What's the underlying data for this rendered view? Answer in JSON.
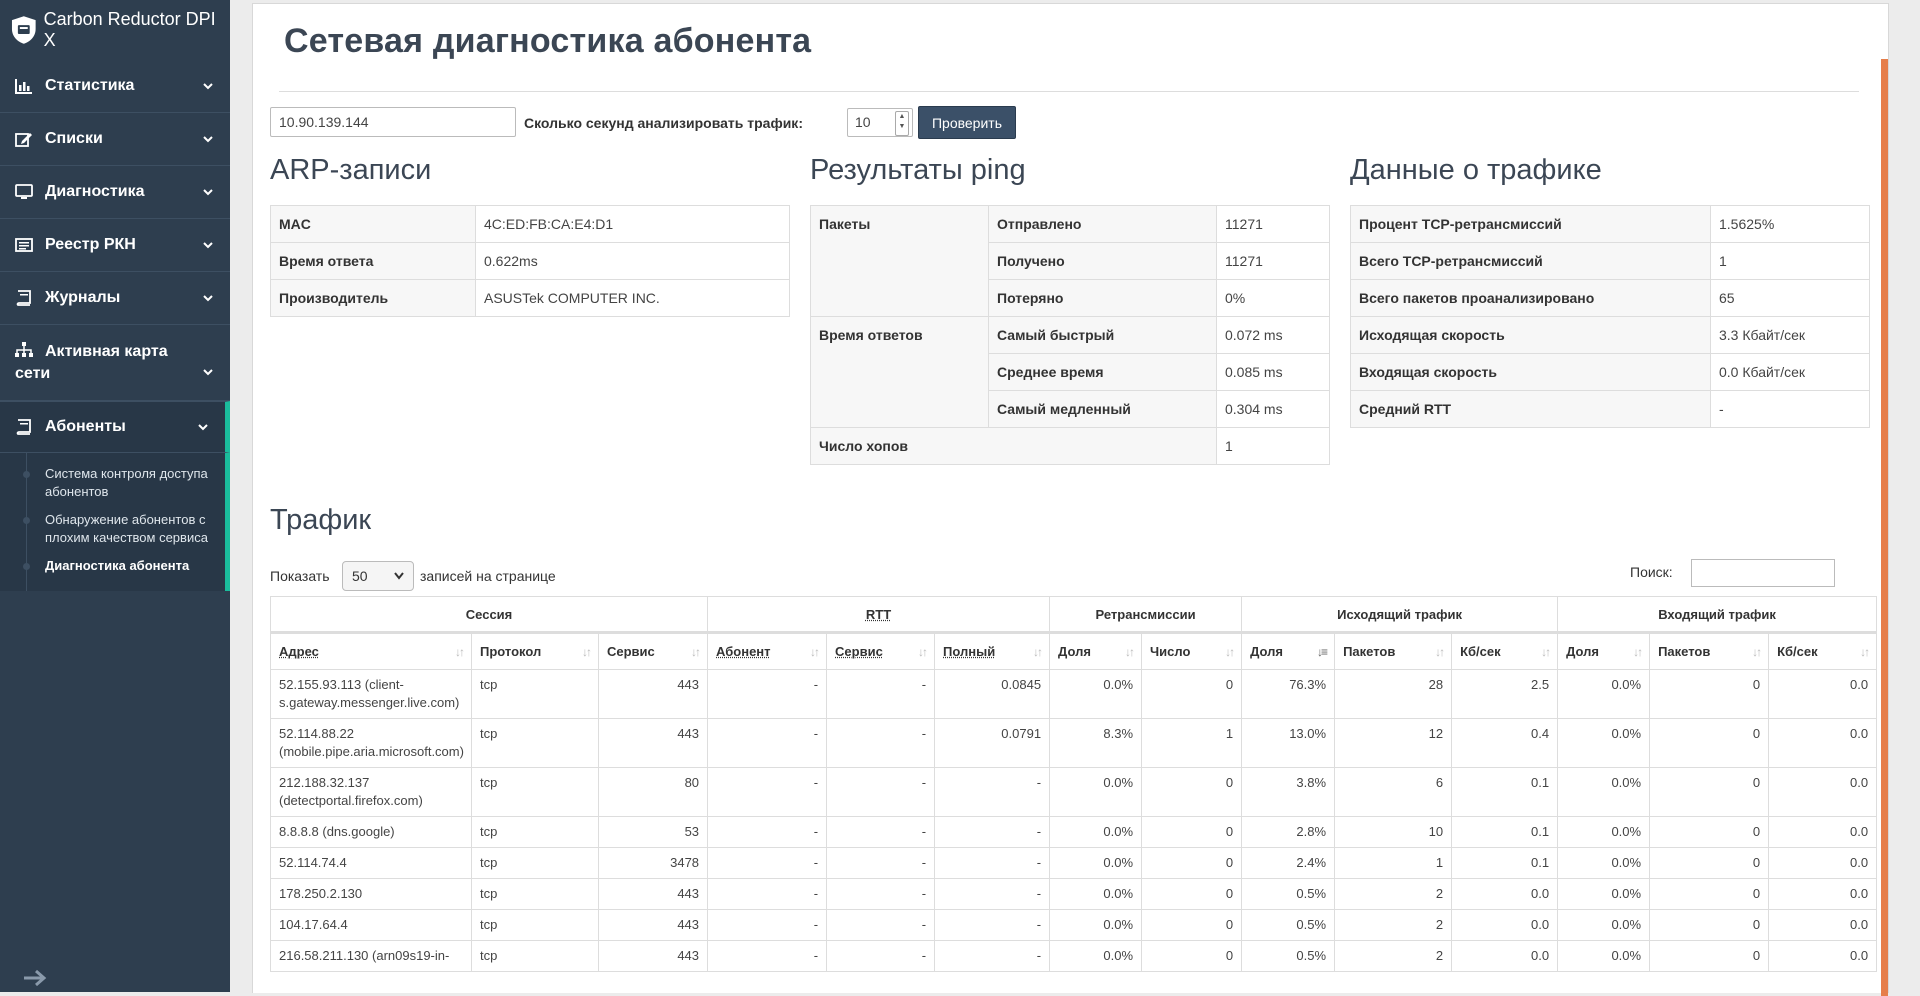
{
  "app": {
    "title": "Carbon Reductor DPI X"
  },
  "sidebar": {
    "items": [
      {
        "label": "Статистика",
        "icon": "bar-chart-icon"
      },
      {
        "label": "Списки",
        "icon": "edit-icon"
      },
      {
        "label": "Диагностика",
        "icon": "monitor-icon"
      },
      {
        "label": "Реестр РКН",
        "icon": "list-icon"
      },
      {
        "label": "Журналы",
        "icon": "book-icon"
      },
      {
        "label": "Активная карта сети",
        "label_line1": "Активная карта",
        "label_line2": "сети",
        "icon": "sitemap-icon"
      },
      {
        "label": "Абоненты",
        "icon": "book-icon"
      }
    ],
    "subitems": [
      {
        "line1": "Система контроля доступа",
        "line2": "абонентов"
      },
      {
        "line1": "Обнаружение абонентов с",
        "line2": "плохим качеством сервиса"
      },
      {
        "line1": "Диагностика абонента"
      }
    ]
  },
  "page": {
    "title": "Сетевая диагностика абонента",
    "ip_value": "10.90.139.144",
    "seconds_label": "Сколько секунд анализировать трафик:",
    "seconds_value": "10",
    "check_button": "Проверить"
  },
  "arp": {
    "heading": "ARP-записи",
    "rows": [
      {
        "k": "MAC",
        "v": "4C:ED:FB:CA:E4:D1"
      },
      {
        "k": "Время ответа",
        "v": "0.622ms"
      },
      {
        "k": "Производитель",
        "v": "ASUSTek COMPUTER INC."
      }
    ]
  },
  "ping": {
    "heading": "Результаты ping",
    "packets_label": "Пакеты",
    "sent_label": "Отправлено",
    "sent": "11271",
    "received_label": "Получено",
    "received": "11271",
    "lost_label": "Потеряно",
    "lost": "0%",
    "times_label": "Время ответов",
    "fastest_label": "Самый быстрый",
    "fastest": "0.072 ms",
    "avg_label": "Среднее время",
    "avg": "0.085 ms",
    "slowest_label": "Самый медленный",
    "slowest": "0.304 ms",
    "hops_label": "Число хопов",
    "hops": "1"
  },
  "traffic_data": {
    "heading": "Данные о трафике",
    "rows": [
      {
        "k": "Процент TCP-ретрансмиссий",
        "v": "1.5625%"
      },
      {
        "k": "Всего TCP-ретрансмиссий",
        "v": "1"
      },
      {
        "k": "Всего пакетов проанализировано",
        "v": "65"
      },
      {
        "k": "Исходящая скорость",
        "v": "3.3 Кбайт/сек"
      },
      {
        "k": "Входящая скорость",
        "v": "0.0 Кбайт/сек"
      },
      {
        "k": "Средний RTT",
        "v": "-"
      }
    ]
  },
  "traffic": {
    "heading": "Трафик",
    "show_label": "Показать",
    "page_size": "50",
    "per_page_label": "записей на странице",
    "search_label": "Поиск:",
    "groups": [
      "Сессия",
      "RTT",
      "Ретрансмиссии",
      "Исходящий трафик",
      "Входящий трафик"
    ],
    "columns": [
      "Адрес",
      "Протокол",
      "Сервис",
      "Абонент",
      "Сервис",
      "Полный",
      "Доля",
      "Число",
      "Доля",
      "Пакетов",
      "Кб/сек",
      "Доля",
      "Пакетов",
      "Кб/сек"
    ],
    "rows": [
      [
        "52.155.93.113 (client-s.gateway.messenger.live.com)",
        "tcp",
        "443",
        "-",
        "-",
        "0.0845",
        "0.0%",
        "0",
        "76.3%",
        "28",
        "2.5",
        "0.0%",
        "0",
        "0.0"
      ],
      [
        "52.114.88.22 (mobile.pipe.aria.microsoft.com)",
        "tcp",
        "443",
        "-",
        "-",
        "0.0791",
        "8.3%",
        "1",
        "13.0%",
        "12",
        "0.4",
        "0.0%",
        "0",
        "0.0"
      ],
      [
        "212.188.32.137 (detectportal.firefox.com)",
        "tcp",
        "80",
        "-",
        "-",
        "-",
        "0.0%",
        "0",
        "3.8%",
        "6",
        "0.1",
        "0.0%",
        "0",
        "0.0"
      ],
      [
        "8.8.8.8 (dns.google)",
        "tcp",
        "53",
        "-",
        "-",
        "-",
        "0.0%",
        "0",
        "2.8%",
        "10",
        "0.1",
        "0.0%",
        "0",
        "0.0"
      ],
      [
        "52.114.74.4",
        "tcp",
        "3478",
        "-",
        "-",
        "-",
        "0.0%",
        "0",
        "2.4%",
        "1",
        "0.1",
        "0.0%",
        "0",
        "0.0"
      ],
      [
        "178.250.2.130",
        "tcp",
        "443",
        "-",
        "-",
        "-",
        "0.0%",
        "0",
        "0.5%",
        "2",
        "0.0",
        "0.0%",
        "0",
        "0.0"
      ],
      [
        "104.17.64.4",
        "tcp",
        "443",
        "-",
        "-",
        "-",
        "0.0%",
        "0",
        "0.5%",
        "2",
        "0.0",
        "0.0%",
        "0",
        "0.0"
      ],
      [
        "216.58.211.130 (arn09s19-in-",
        "tcp",
        "443",
        "-",
        "-",
        "-",
        "0.0%",
        "0",
        "0.5%",
        "2",
        "0.0",
        "0.0%",
        "0",
        "0.0"
      ]
    ]
  }
}
